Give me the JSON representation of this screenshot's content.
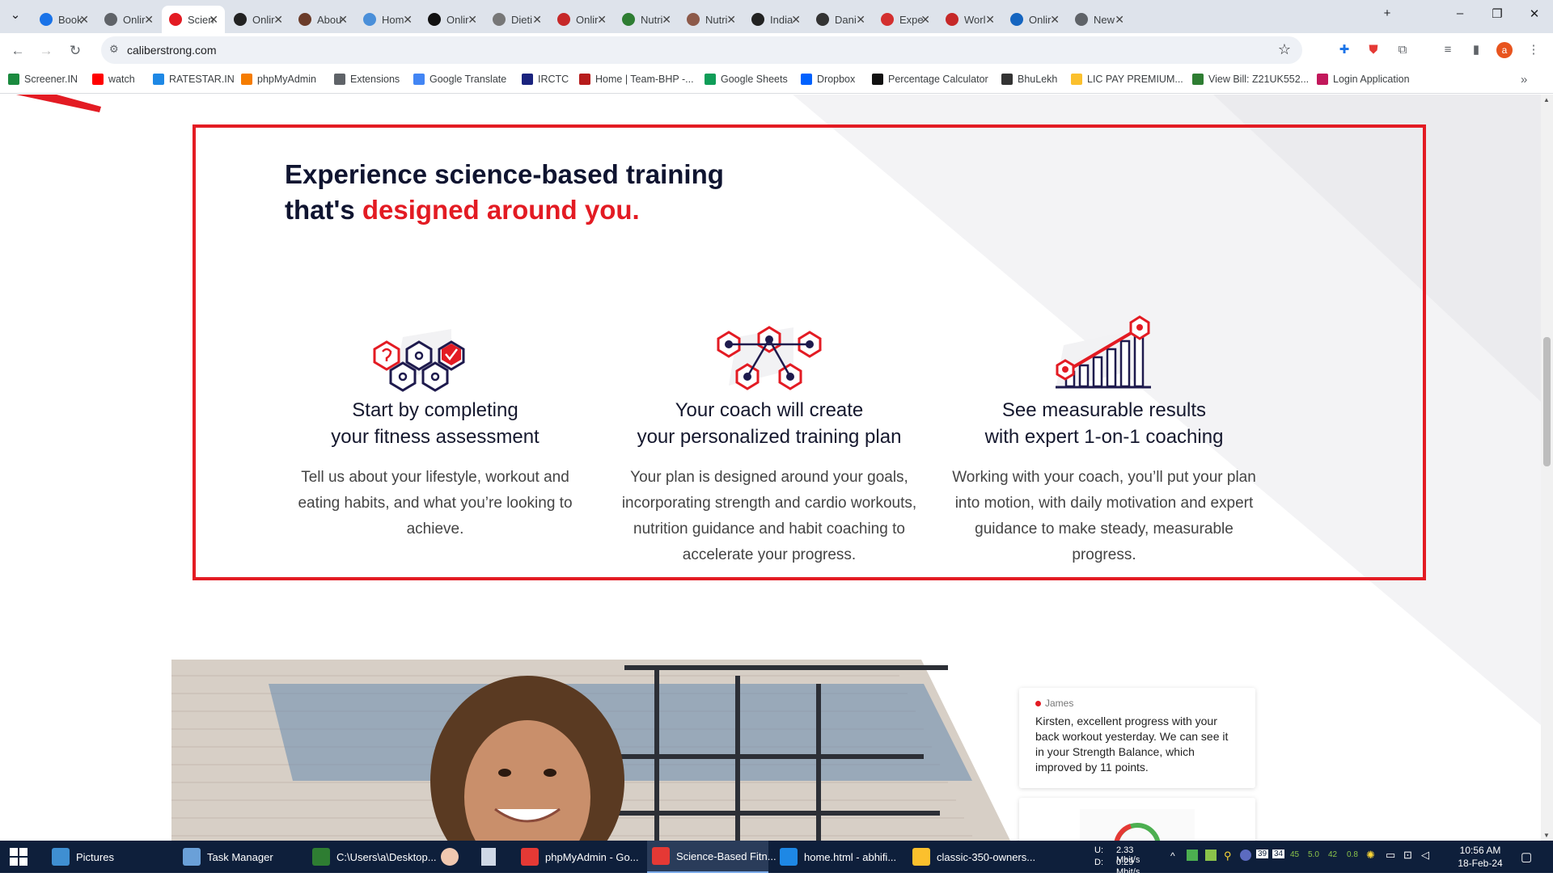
{
  "tabs": [
    {
      "label": "Book",
      "icon": "star-icon",
      "color": "#1a73e8"
    },
    {
      "label": "Onlir",
      "icon": "globe-icon",
      "color": "#5f6368"
    },
    {
      "label": "Scien",
      "icon": "caliber-icon",
      "color": "#e31b23",
      "active": true
    },
    {
      "label": "Onlir",
      "icon": "github-icon",
      "color": "#222"
    },
    {
      "label": "Abou",
      "icon": "about-icon",
      "color": "#6b3c2a"
    },
    {
      "label": "Hom",
      "icon": "home-icon",
      "color": "#4a8fd9"
    },
    {
      "label": "Onlir",
      "icon": "wf-icon",
      "color": "#111"
    },
    {
      "label": "Dieti",
      "icon": "diet-icon",
      "color": "#777"
    },
    {
      "label": "Onlir",
      "icon": "pdf-icon",
      "color": "#c62828"
    },
    {
      "label": "Nutri",
      "icon": "nutrition-icon",
      "color": "#2e7d32"
    },
    {
      "label": "Nutri",
      "icon": "person-icon",
      "color": "#8d5a4a"
    },
    {
      "label": "India",
      "icon": "pin-icon",
      "color": "#222"
    },
    {
      "label": "Dani",
      "icon": "dani-icon",
      "color": "#333"
    },
    {
      "label": "Expe",
      "icon": "expe-icon",
      "color": "#d32f2f"
    },
    {
      "label": "Worl",
      "icon": "world-icon",
      "color": "#c62828"
    },
    {
      "label": "Onlir",
      "icon": "list-icon",
      "color": "#1565c0"
    },
    {
      "label": "New",
      "icon": "chrome-icon",
      "color": "#5f6368"
    }
  ],
  "url": "caliberstrong.com",
  "bookmarks": [
    {
      "label": "Screener.IN",
      "color": "#1b8a3f"
    },
    {
      "label": "watch",
      "color": "#ff0000"
    },
    {
      "label": "RATESTAR.IN",
      "color": "#1e88e5"
    },
    {
      "label": "phpMyAdmin",
      "color": "#f57c00"
    },
    {
      "label": "Extensions",
      "color": "#5f6368"
    },
    {
      "label": "Google Translate",
      "color": "#4285f4"
    },
    {
      "label": "IRCTC",
      "color": "#1a237e"
    },
    {
      "label": "Home | Team-BHP -...",
      "color": "#b71c1c"
    },
    {
      "label": "Google Sheets",
      "color": "#0f9d58"
    },
    {
      "label": "Dropbox",
      "color": "#0061fe"
    },
    {
      "label": "Percentage Calculator",
      "color": "#111"
    },
    {
      "label": "BhuLekh",
      "color": "#333"
    },
    {
      "label": "LIC PAY PREMIUM...",
      "color": "#fbc02d"
    },
    {
      "label": "View Bill: Z21UK552...",
      "color": "#2e7d32"
    },
    {
      "label": "Login Application",
      "color": "#c2185b"
    }
  ],
  "page": {
    "headline_line1": "Experience science-based training",
    "headline_line2_prefix": "that's ",
    "headline_line2_highlight": "designed around you.",
    "steps": [
      {
        "title_line1": "Start by completing",
        "title_line2": "your fitness assessment",
        "body": "Tell us about your lifestyle, workout and eating habits, and what you’re looking to achieve.",
        "icon": "hexagon-assessment-icon"
      },
      {
        "title_line1": "Your coach will create",
        "title_line2": "your personalized training plan",
        "body": "Your plan is designed around your goals, incorporating strength and cardio workouts, nutrition guidance and habit coaching to accelerate your progress.",
        "icon": "hexagon-network-icon"
      },
      {
        "title_line1": "See measurable results",
        "title_line2": "with expert 1-on-1 coaching",
        "body": "Working with your coach, you’ll put your plan into motion, with daily motivation and expert guidance to make steady, measurable progress.",
        "icon": "growth-chart-icon"
      }
    ],
    "message": {
      "name": "James",
      "text": "Kirsten, excellent progress with your back workout yesterday. We can see it in your Strength Balance, which improved by 11 points."
    }
  },
  "taskbar": {
    "items": [
      {
        "label": "Pictures",
        "color": "#3f8fd2"
      },
      {
        "label": "Task Manager",
        "color": "#6aa0d8"
      },
      {
        "label": "C:\\Users\\a\\Desktop...",
        "color": "#2e7d32"
      },
      {
        "label": "phpMyAdmin - Go...",
        "color": "#e53935"
      },
      {
        "label": "Science-Based Fitn...",
        "color": "#e53935",
        "active": true
      },
      {
        "label": "home.html - abhifi...",
        "color": "#1e88e5"
      },
      {
        "label": "classic-350-owners...",
        "color": "#fbc02d"
      }
    ],
    "net_up_label": "U:",
    "net_down_label": "D:",
    "net_up": "2.33 Mbit/s",
    "net_down": "0.29 Mbit/s",
    "tray_numbers": [
      "39",
      "34",
      "45",
      "5.0",
      "42",
      "0.8"
    ],
    "time": "10:56 AM",
    "date": "18-Feb-24"
  },
  "colors": {
    "accent_red": "#e31b23",
    "navy": "#1e1a4d",
    "taskbar": "#0e1f3b"
  }
}
